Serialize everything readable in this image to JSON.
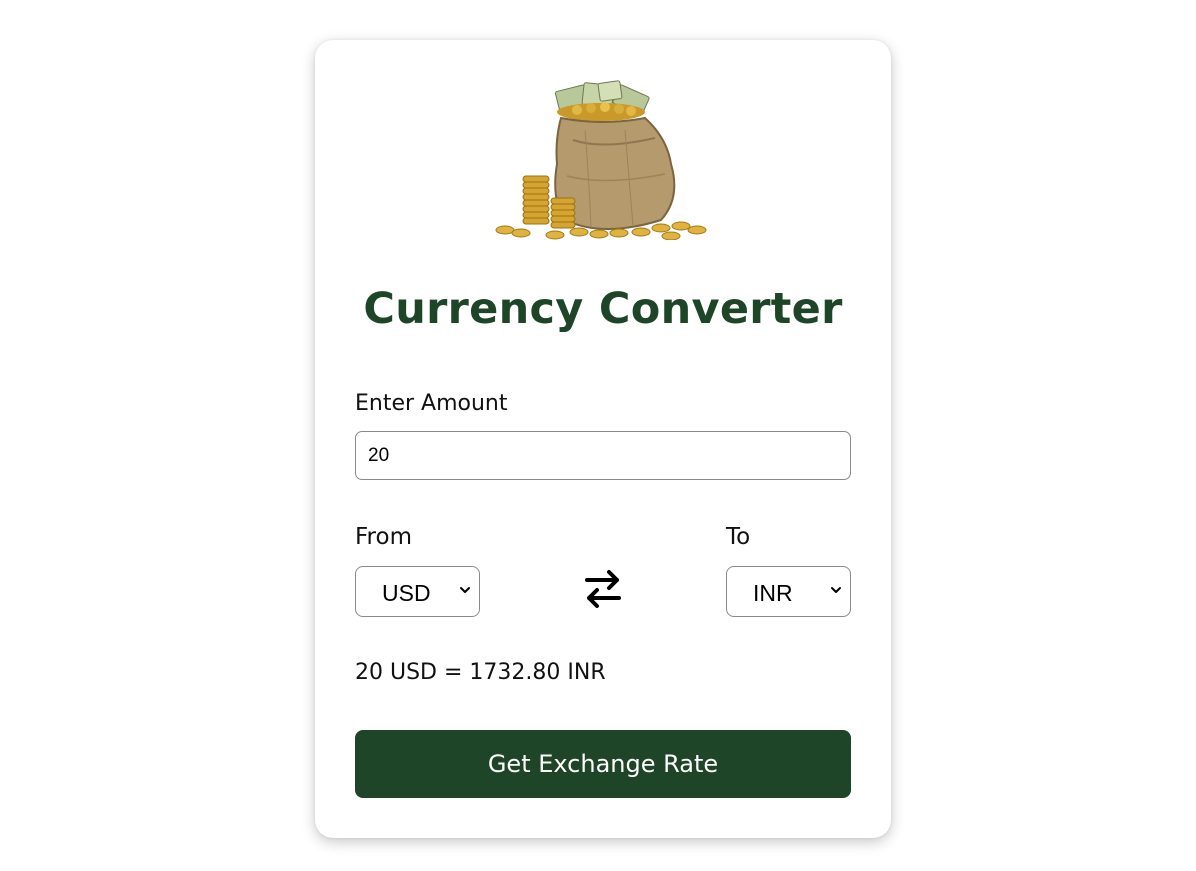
{
  "app": {
    "title": "Currency Converter"
  },
  "form": {
    "amount_label": "Enter Amount",
    "amount_value": "20",
    "from_label": "From",
    "from_selected": "USD",
    "to_label": "To",
    "to_selected": "INR",
    "swap_icon": "swap-arrows-icon"
  },
  "result": {
    "text": "20 USD = 1732.80 INR"
  },
  "actions": {
    "submit_label": "Get Exchange Rate"
  },
  "colors": {
    "brand": "#1e4528",
    "button_text": "#ffffff"
  },
  "images": {
    "hero": "money-bag-with-coins"
  }
}
